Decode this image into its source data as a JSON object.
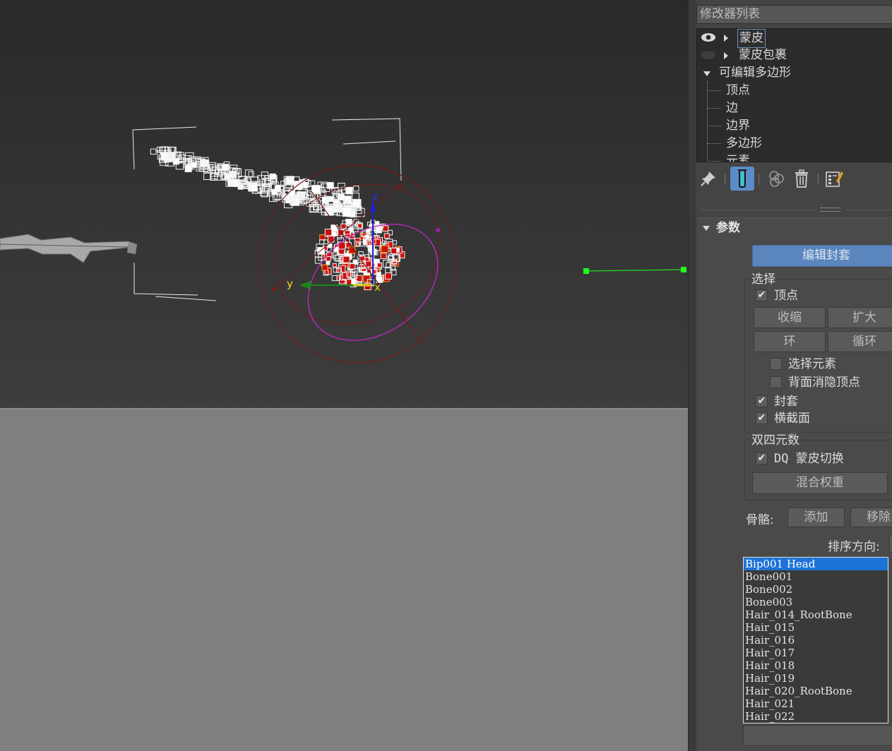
{
  "viewport": {
    "axis_x": "x",
    "axis_y": "y",
    "axis_z": "z",
    "colors": {
      "sky": "#333333",
      "ground": "#7f7f7f",
      "envelope_outer": "#8b1a1a",
      "envelope_inner": "#c020c0",
      "helper_line": "#22dd22"
    }
  },
  "modifier_panel": {
    "modifier_list_label": "修改器列表",
    "stack": [
      {
        "label": "蒙皮",
        "icon": "eye-icon",
        "expand": "collapsed",
        "selected": true
      },
      {
        "label": "蒙皮包裹",
        "icon": "eye-off-icon",
        "expand": "collapsed",
        "selected": false
      },
      {
        "label": "可编辑多边形",
        "expand": "expanded",
        "selected": false
      },
      {
        "label": "顶点",
        "sub": true
      },
      {
        "label": "边",
        "sub": true
      },
      {
        "label": "边界",
        "sub": true
      },
      {
        "label": "多边形",
        "sub": true
      },
      {
        "label": "元素",
        "sub": true
      }
    ],
    "toolbar": [
      "pin-stack-icon",
      "show-end-result-icon",
      "make-unique-icon",
      "remove-modifier-icon",
      "configure-modifier-sets-icon"
    ]
  },
  "parameters": {
    "title": "参数",
    "edit_envelopes_label": "编辑封套",
    "selection_group_title": "选择",
    "vertices_label": "顶点",
    "vertices_checked": true,
    "shrink_label": "收缩",
    "grow_label": "扩大",
    "ring_label": "环",
    "loop_label": "循环",
    "select_element_label": "选择元素",
    "select_element_checked": false,
    "backface_cull_label": "背面消隐顶点",
    "backface_cull_checked": false,
    "envelopes_label": "封套",
    "envelopes_checked": true,
    "cross_sections_label": "横截面",
    "cross_sections_checked": true,
    "dq_group_title": "双四元数",
    "dq_toggle_label": "DQ 蒙皮切换",
    "dq_toggle_checked": true,
    "blend_weights_label": "混合权重",
    "bones_label": "骨骼:",
    "add_label": "添加",
    "remove_label": "移除",
    "sort_label": "排序方向:",
    "bones": [
      "Bip001 Head",
      "Bone001",
      "Bone002",
      "Bone003",
      "Hair_014_RootBone",
      "Hair_015",
      "Hair_016",
      "Hair_017",
      "Hair_018",
      "Hair_019",
      "Hair_020_RootBone",
      "Hair_021",
      "Hair_022"
    ],
    "selected_bone": "Bip001 Head"
  }
}
